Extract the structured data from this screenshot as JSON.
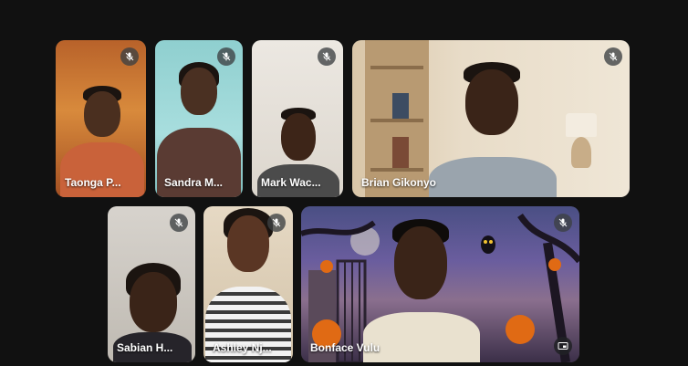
{
  "participants": [
    {
      "name": "Taonga P...",
      "mic": "mic-off-icon"
    },
    {
      "name": "Sandra M...",
      "mic": "mic-off-icon"
    },
    {
      "name": "Mark Wac...",
      "mic": "mic-off-icon"
    },
    {
      "name": "Brian Gikonyo",
      "mic": "mic-off-icon"
    },
    {
      "name": "Sabian H...",
      "mic": "mic-off-icon"
    },
    {
      "name": "Ashley Nj...",
      "mic": "mic-off-icon"
    },
    {
      "name": "Bonface Vulu",
      "mic": "mic-off-icon"
    }
  ],
  "colors": {
    "background": "#111111",
    "tile_overlay": "#3c4043",
    "name_text": "#ffffff"
  }
}
